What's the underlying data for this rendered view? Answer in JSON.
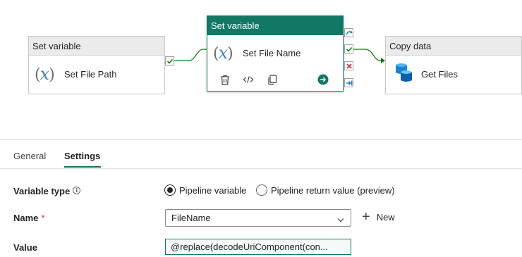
{
  "pipeline": {
    "activities": [
      {
        "type": "Set variable",
        "name": "Set File Path",
        "icon": "variable-icon"
      },
      {
        "type": "Set variable",
        "name": "Set File Name",
        "icon": "variable-icon",
        "selected": true
      },
      {
        "type": "Copy data",
        "name": "Get Files",
        "icon": "database-icon"
      }
    ],
    "toolbar_icons": [
      "trash-icon",
      "code-icon",
      "copy-icon",
      "arrow-right-circle-icon"
    ],
    "port_icons": [
      "skip-icon",
      "success-icon",
      "failure-icon",
      "completion-icon"
    ],
    "colors": {
      "accent": "#117865",
      "success": "#107c10",
      "failure": "#c4314b",
      "link": "#0f6cbd"
    }
  },
  "tabs": [
    {
      "label": "General"
    },
    {
      "label": "Settings",
      "active": true
    }
  ],
  "settings": {
    "variable_type_label": "Variable type",
    "variable_type_options": [
      {
        "label": "Pipeline variable",
        "checked": true
      },
      {
        "label": "Pipeline return value (preview)",
        "checked": false
      }
    ],
    "name_label": "Name",
    "name_required_mark": "*",
    "name_value": "FileName",
    "new_label": "New",
    "value_label": "Value",
    "value_text": "@replace(decodeUriComponent(con..."
  }
}
